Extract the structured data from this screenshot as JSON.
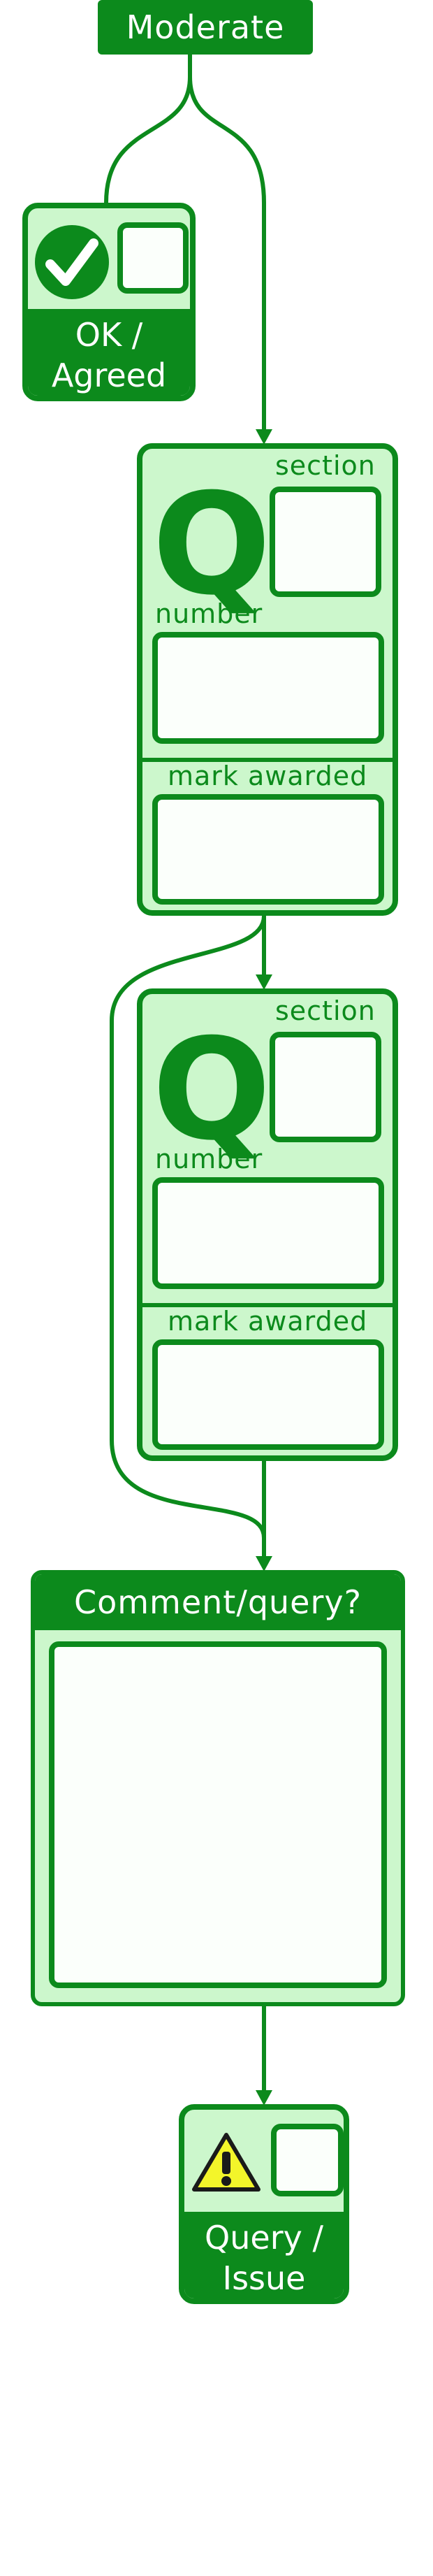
{
  "header": {
    "title": "Moderate"
  },
  "ok_card": {
    "line1": "OK /",
    "line2": "Agreed"
  },
  "question_card_1": {
    "section_label": "section",
    "q_glyph": "Q",
    "number_label": "number",
    "mark_label": "mark awarded"
  },
  "question_card_2": {
    "section_label": "section",
    "q_glyph": "Q",
    "number_label": "number",
    "mark_label": "mark awarded"
  },
  "comment": {
    "title": "Comment/query?"
  },
  "query_card": {
    "line1": "Query /",
    "line2": "Issue"
  },
  "colors": {
    "dark_green": "#0c8a1c",
    "light_green": "#ccf7cc",
    "warning_yellow": "#f3f52a"
  },
  "icons": [
    "checkmark-icon",
    "warning-icon"
  ]
}
